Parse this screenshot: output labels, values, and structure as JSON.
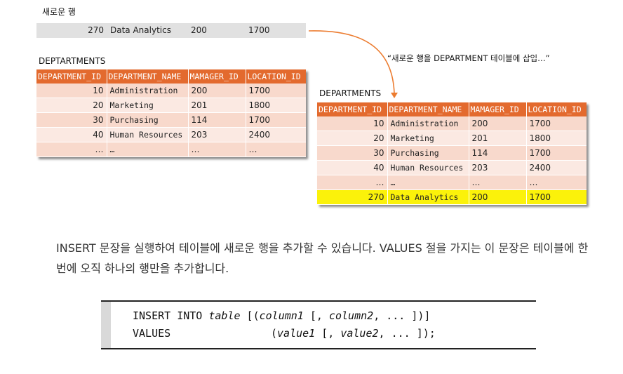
{
  "new_row_label": "새로운 행",
  "new_row": {
    "id": "270",
    "name": "Data Analytics",
    "manager": "200",
    "location": "1700"
  },
  "left_table": {
    "title": "DEPTARTMENTS",
    "headers": [
      "DEPARTMENT_ID",
      "DEPARTMENT_NAME",
      "MAMAGER_ID",
      "LOCATION_ID"
    ],
    "rows": [
      [
        "10",
        "Administration",
        "200",
        "1700"
      ],
      [
        "20",
        "Marketing",
        "201",
        "1800"
      ],
      [
        "30",
        "Purchasing",
        "114",
        "1700"
      ],
      [
        "40",
        "Human Resources",
        "203",
        "2400"
      ],
      [
        "…",
        "…",
        "…",
        "…"
      ]
    ]
  },
  "callout": "“새로운 행을 DEPARTMENT 테이블에 삽입…”",
  "right_table": {
    "title": "DEPARTMENTS",
    "headers": [
      "DEPARTMENT_ID",
      "DEPARTMENT_NAME",
      "MAMAGER_ID",
      "LOCATION_ID"
    ],
    "rows": [
      [
        "10",
        "Administration",
        "200",
        "1700"
      ],
      [
        "20",
        "Marketing",
        "201",
        "1800"
      ],
      [
        "30",
        "Purchasing",
        "114",
        "1700"
      ],
      [
        "40",
        "Human Resources",
        "203",
        "2400"
      ],
      [
        "…",
        "…",
        "…",
        "…"
      ],
      [
        "270",
        "Data Analytics",
        "200",
        "1700"
      ]
    ]
  },
  "description": "INSERT 문장을 실행하여 테이블에 새로운 행을 추가할 수 있습니다. VALUES 절을 가지는 이 문장은 테이블에 한번에 오직 하나의 행만을 추가합니다.",
  "syntax": {
    "line1_kw1": "INSERT INTO ",
    "line1_table": "table",
    "line1_p1": " [(",
    "line1_col1": "column1",
    "line1_p2": " [, ",
    "line1_col2": "column2",
    "line1_p3": ", ... ])]",
    "line2_kw": "VALUES",
    "line2_p1": "(",
    "line2_val1": "value1",
    "line2_p2": " [, ",
    "line2_val2": "value2",
    "line2_p3": ", ... ]);"
  },
  "colors": {
    "header_orange": "#e36a2e",
    "row_pink": "#f8d9cc",
    "row_light": "#fbe9e2",
    "highlight_yellow": "#fbf20a",
    "arrow_orange": "#ec7c30"
  }
}
